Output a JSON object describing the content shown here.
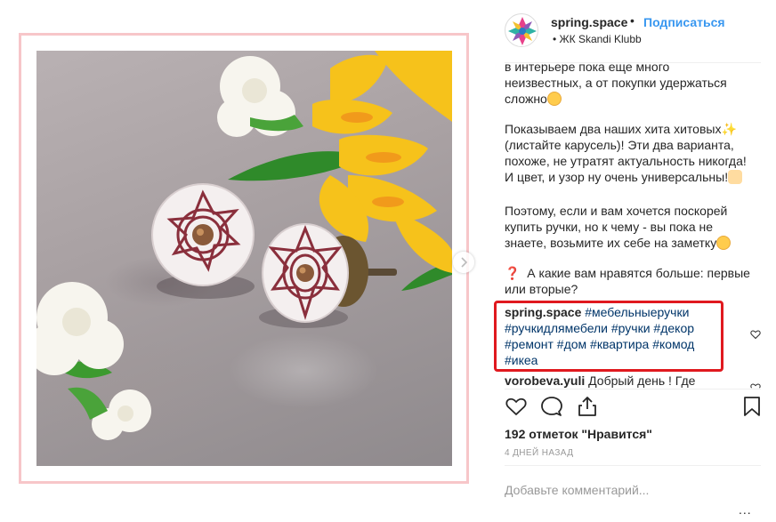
{
  "post": {
    "author": "spring.space",
    "dot": "•",
    "follow_label": "Подписаться",
    "location": "ЖК Skandi Klubb"
  },
  "caption": {
    "line1": "в интерьере пока еще много",
    "line2": "неизвестных, а от покупки удержаться",
    "line3": "сложно",
    "para2_l1": "Показываем два наших хита хитовых",
    "para2_l2": "(листайте карусель)! Эти два варианта,",
    "para2_l3": "похоже, не утратят актуальность никогда!",
    "para2_l4": "И цвет, и узор ну очень универсальны!",
    "para3_l1": "Поэтому, если и вам хочется поскорей",
    "para3_l2": "купить ручки, но к чему - вы пока не",
    "para3_l3": "знаете, возьмите их себе на заметку",
    "question_mark": "❓",
    "question_l1": "А какие вам нравятся больше: первые",
    "question_l2": "или вторые?"
  },
  "hashtag_comment": {
    "user": "spring.space",
    "tags_l1": "#мебельныеручки",
    "tags_l2": "#ручкидлямебели #ручки #декор",
    "tags_l3": "#ремонт #дом #квартира #комод",
    "tags_l4": "#икеа"
  },
  "next_comment": {
    "user": "vorobeva.yuli",
    "text": "Добрый день ! Где"
  },
  "footer": {
    "likes": "192 отметок \"Нравится\"",
    "timestamp": "4 ДНЕЙ НАЗАД",
    "comment_placeholder": "Добавьте комментарий...",
    "more": "..."
  },
  "icons": {
    "like": "heart-icon",
    "comment": "comment-icon",
    "share": "share-icon",
    "save": "bookmark-icon",
    "next": "chevron-right-icon"
  },
  "colors": {
    "accent": "#3897f0",
    "hashtag": "#003569",
    "highlight_border": "#e0191f",
    "frame_border": "#f7c6c9"
  }
}
